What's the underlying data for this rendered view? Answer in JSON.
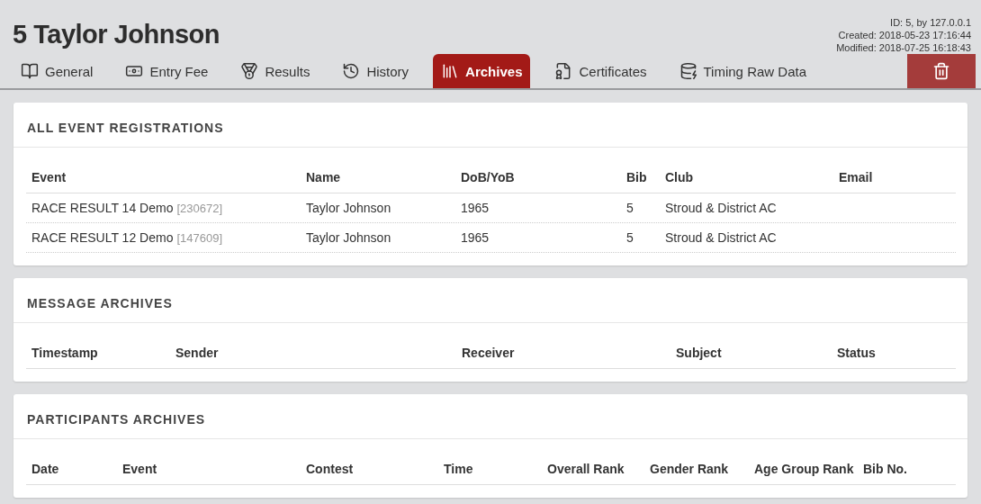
{
  "title": "5 Taylor Johnson",
  "meta": [
    "ID: 5, by 127.0.0.1",
    "Created: 2018-05-23 17:16:44",
    "Modified: 2018-07-25 16:18:43"
  ],
  "tabs": [
    {
      "label": "General",
      "selected": false
    },
    {
      "label": "Entry Fee",
      "selected": false
    },
    {
      "label": "Results",
      "selected": false
    },
    {
      "label": "History",
      "selected": false
    },
    {
      "label": "Archives",
      "selected": true
    },
    {
      "label": "Certificates",
      "selected": false
    },
    {
      "label": "Timing Raw Data",
      "selected": false
    }
  ],
  "registrations": {
    "title": "ALL EVENT REGISTRATIONS",
    "columns": [
      "Event",
      "Name",
      "DoB/YoB",
      "Bib",
      "Club",
      "Email"
    ],
    "rows": [
      {
        "event": "RACE RESULT 14 Demo",
        "event_id": "[230672]",
        "name": "Taylor Johnson",
        "dob": "1965",
        "bib": "5",
        "club": "Stroud & District AC"
      },
      {
        "event": "RACE RESULT 12 Demo",
        "event_id": "[147609]",
        "name": "Taylor Johnson",
        "dob": "1965",
        "bib": "5",
        "club": "Stroud & District AC"
      }
    ]
  },
  "messages": {
    "title": "MESSAGE ARCHIVES",
    "columns": [
      "Timestamp",
      "Sender",
      "Receiver",
      "Subject",
      "Status"
    ]
  },
  "participants": {
    "title": "PARTICIPANTS ARCHIVES",
    "columns": [
      "Date",
      "Event",
      "Contest",
      "Time",
      "Overall Rank",
      "Gender Rank",
      "Age Group Rank",
      "Bib No."
    ]
  }
}
